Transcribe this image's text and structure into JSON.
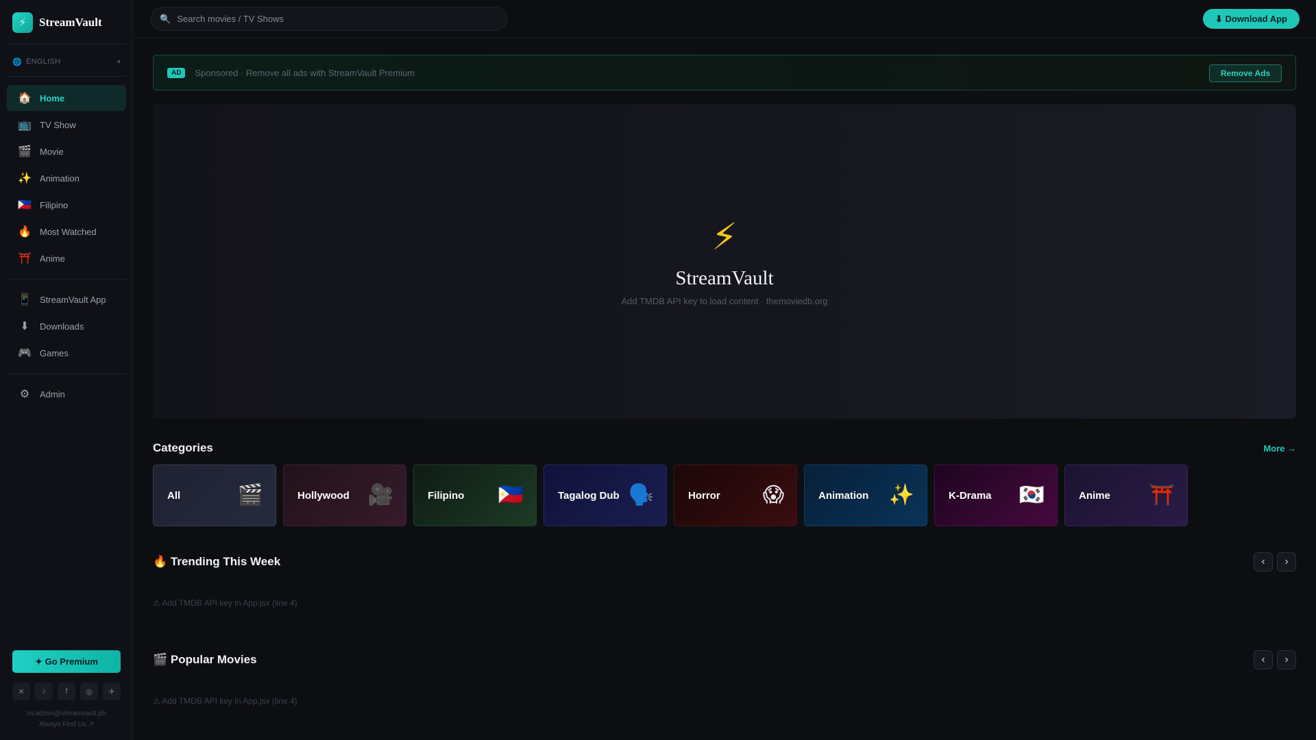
{
  "app": {
    "name": "StreamVault",
    "logo_icon": "⚡"
  },
  "language": {
    "icon": "🌐",
    "label": "ENGLISH",
    "chevron": "▾"
  },
  "sidebar": {
    "nav": [
      {
        "icon": "🏠",
        "label": "Home",
        "active": true
      },
      {
        "icon": "📺",
        "label": "TV Show"
      },
      {
        "icon": "🎬",
        "label": "Movie"
      },
      {
        "icon": "✨",
        "label": "Animation"
      },
      {
        "icon": "🇵🇭",
        "label": "Filipino"
      },
      {
        "icon": "🔥",
        "label": "Most Watched"
      },
      {
        "icon": "⛩️",
        "label": "Anime"
      }
    ],
    "nav_extra": [
      {
        "icon": "📱",
        "label": "StreamVault App"
      },
      {
        "icon": "⬇",
        "label": "Downloads"
      },
      {
        "icon": "🎮",
        "label": "Games"
      }
    ],
    "admin": {
      "icon": "⚙",
      "label": "Admin"
    },
    "premium_label": "✦ Go Premium",
    "socials": [
      "✕",
      "♪",
      "f",
      "◎",
      "✈"
    ],
    "email": "sv.admin@streamvault.ph",
    "find_us": "Always Find Us ↗"
  },
  "topbar": {
    "search_icon": "🔍",
    "search_placeholder": "Search movies / TV Shows",
    "download_label": "⬇ Download App"
  },
  "ad": {
    "tag": "AD",
    "text": "Sponsored · Remove all ads with StreamVault Premium",
    "button": "Remove Ads"
  },
  "hero": {
    "icon": "⚡",
    "title": "StreamVault",
    "subtitle": "Add TMDB API key to load content · themoviedb.org"
  },
  "categories": {
    "title": "Categories",
    "more": "More →",
    "items": [
      {
        "label": "All",
        "emoji": "🎬"
      },
      {
        "label": "Hollywood",
        "emoji": "🎥"
      },
      {
        "label": "Filipino",
        "emoji": "🇵🇭"
      },
      {
        "label": "Tagalog Dub",
        "emoji": "🗣️"
      },
      {
        "label": "Horror",
        "emoji": "😱"
      },
      {
        "label": "Animation",
        "emoji": "✨"
      },
      {
        "label": "K-Drama",
        "emoji": "🇰🇷"
      },
      {
        "label": "Anime",
        "emoji": "⛩️"
      }
    ]
  },
  "trending": {
    "title": "🔥 Trending This Week",
    "warning": "⚠ Add TMDB API key in App.jsx (line 4)",
    "prev": "‹",
    "next": "›"
  },
  "popular": {
    "title": "🎬 Popular Movies",
    "warning": "⚠ Add TMDB API key in App.jsx (line 4)",
    "prev": "‹",
    "next": "›"
  },
  "colors": {
    "accent": "#1fc7b9",
    "background": "#0d0e12",
    "sidebar": "#101116"
  }
}
